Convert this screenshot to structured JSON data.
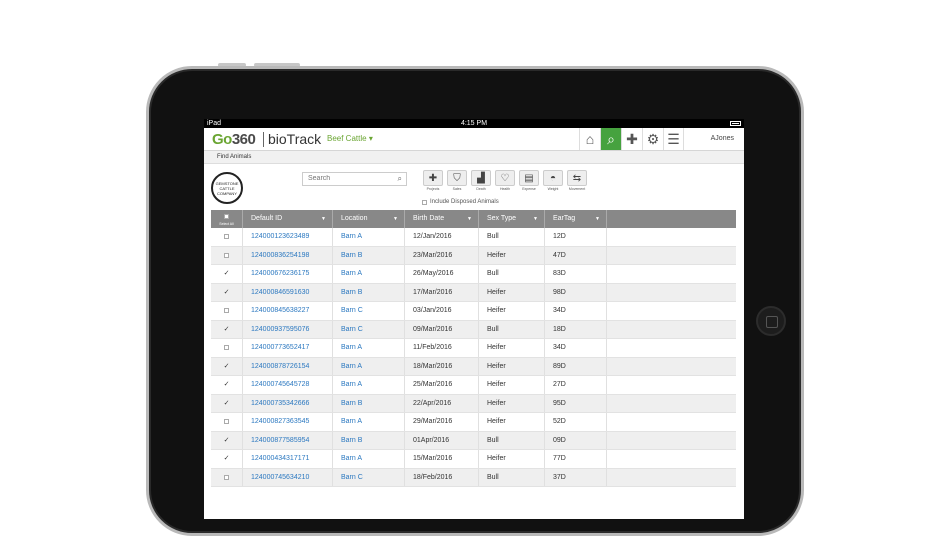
{
  "device": {
    "carrier": "iPad",
    "time": "4:15 PM"
  },
  "header": {
    "logo_prefix": "Go",
    "logo_suffix": "360",
    "product": "bioTrack",
    "category": "Beef Cattle",
    "user": "AJones",
    "nav_icons": [
      "home-icon",
      "search-icon",
      "plus-icon",
      "gear-icon",
      "menu-icon"
    ]
  },
  "subbar": {
    "title": "Find Animals"
  },
  "toolbar": {
    "search_placeholder": "Search",
    "tools": [
      {
        "label": "Projects",
        "icon": "plus-icon"
      },
      {
        "label": "Sales",
        "icon": "tag-icon"
      },
      {
        "label": "Death",
        "icon": "tombstone-icon"
      },
      {
        "label": "Health",
        "icon": "heart-icon"
      },
      {
        "label": "Expense",
        "icon": "receipt-icon"
      },
      {
        "label": "Weight",
        "icon": "scale-icon"
      },
      {
        "label": "Movement",
        "icon": "arrows-icon"
      }
    ],
    "include_disposed": "Include Disposed Animals"
  },
  "brand": {
    "text": "GEMSTONE CATTLE COMPANY"
  },
  "table": {
    "select_all": "Select All",
    "columns": [
      "Default ID",
      "Location",
      "Birth Date",
      "Sex Type",
      "EarTag"
    ],
    "rows": [
      {
        "checked": false,
        "id": "124000123623489",
        "location": "Barn A",
        "birth": "12/Jan/2016",
        "sex": "Bull",
        "eartag": "12D"
      },
      {
        "checked": false,
        "id": "124000836254198",
        "location": "Barn B",
        "birth": "23/Mar/2016",
        "sex": "Heifer",
        "eartag": "47D"
      },
      {
        "checked": true,
        "id": "124000676236175",
        "location": "Barn A",
        "birth": "26/May/2016",
        "sex": "Bull",
        "eartag": "83D"
      },
      {
        "checked": true,
        "id": "124000846591630",
        "location": "Barn B",
        "birth": "17/Mar/2016",
        "sex": "Heifer",
        "eartag": "98D"
      },
      {
        "checked": false,
        "id": "124000845638227",
        "location": "Barn C",
        "birth": "03/Jan/2016",
        "sex": "Heifer",
        "eartag": "34D"
      },
      {
        "checked": true,
        "id": "124000937595076",
        "location": "Barn C",
        "birth": "09/Mar/2016",
        "sex": "Bull",
        "eartag": "18D"
      },
      {
        "checked": false,
        "id": "124000773652417",
        "location": "Barn A",
        "birth": "11/Feb/2016",
        "sex": "Heifer",
        "eartag": "34D"
      },
      {
        "checked": true,
        "id": "124000878726154",
        "location": "Barn A",
        "birth": "18/Mar/2016",
        "sex": "Heifer",
        "eartag": "89D"
      },
      {
        "checked": true,
        "id": "124000745645728",
        "location": "Barn A",
        "birth": "25/Mar/2016",
        "sex": "Heifer",
        "eartag": "27D"
      },
      {
        "checked": true,
        "id": "124000735342666",
        "location": "Barn B",
        "birth": "22/Apr/2016",
        "sex": "Heifer",
        "eartag": "95D"
      },
      {
        "checked": false,
        "id": "124000827363545",
        "location": "Barn A",
        "birth": "29/Mar/2016",
        "sex": "Heifer",
        "eartag": "52D"
      },
      {
        "checked": true,
        "id": "124000877585954",
        "location": "Barn B",
        "birth": "01Apr/2016",
        "sex": "Bull",
        "eartag": "09D"
      },
      {
        "checked": true,
        "id": "124000434317171",
        "location": "Barn A",
        "birth": "15/Mar/2016",
        "sex": "Heifer",
        "eartag": "77D"
      },
      {
        "checked": false,
        "id": "124000745634210",
        "location": "Barn C",
        "birth": "18/Feb/2016",
        "sex": "Bull",
        "eartag": "37D"
      }
    ]
  }
}
